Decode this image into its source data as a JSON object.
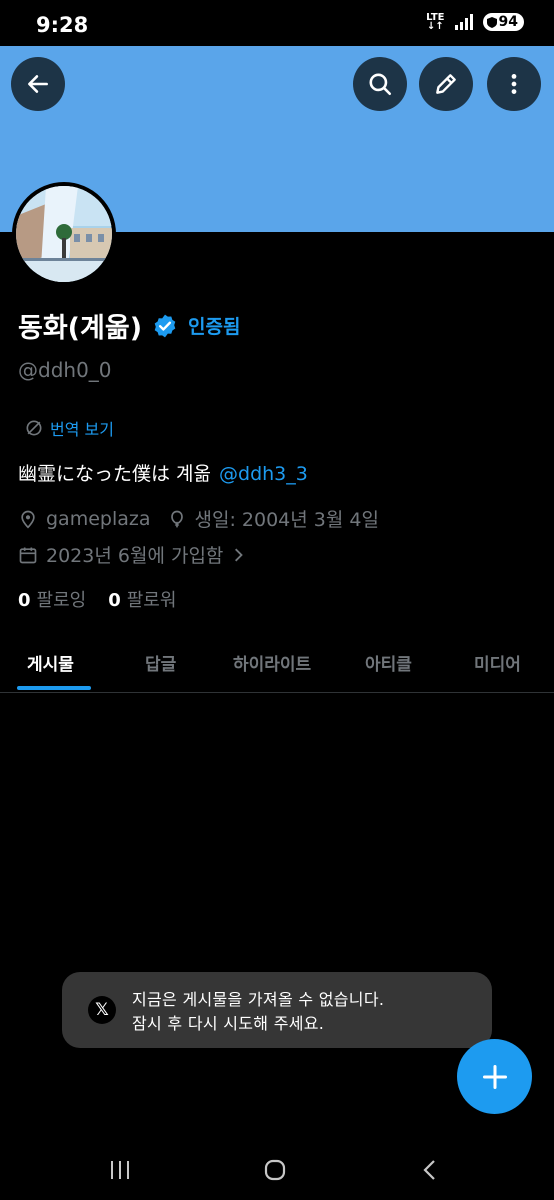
{
  "status_bar": {
    "time": "9:28",
    "network": "LTE",
    "battery": "94"
  },
  "profile": {
    "display_name": "동화(계옮)",
    "verified_label": "인증됨",
    "handle": "@ddh0_0",
    "translate_label": "번역 보기",
    "bio_text": "幽霊になった僕は 계옮",
    "bio_mention": "@ddh3_3",
    "location": "gameplaza",
    "birthday": "생일: 2004년 3월 4일",
    "joined": "2023년 6월에 가입함",
    "following_count": "0",
    "following_label": "팔로잉",
    "followers_count": "0",
    "followers_label": "팔로워"
  },
  "tabs": [
    {
      "label": "게시물",
      "active": true
    },
    {
      "label": "답글",
      "active": false
    },
    {
      "label": "하이라이트",
      "active": false
    },
    {
      "label": "아티클",
      "active": false
    },
    {
      "label": "미디어",
      "active": false
    }
  ],
  "toast": {
    "line1": "지금은 게시물을 가져올 수 없습니다.",
    "line2": "잠시 후 다시 시도해 주세요."
  },
  "icons": {
    "back": "arrow-left-icon",
    "search": "search-icon",
    "edit": "pencil-icon",
    "more": "more-vertical-icon",
    "verified": "verified-badge-icon",
    "translate": "translate-icon",
    "location": "location-pin-icon",
    "birthday": "balloon-icon",
    "calendar": "calendar-icon",
    "compose": "plus-icon"
  },
  "colors": {
    "banner": "#5aa5ea",
    "accent": "#1d9bf0",
    "background": "#000000",
    "muted": "#71767b"
  }
}
